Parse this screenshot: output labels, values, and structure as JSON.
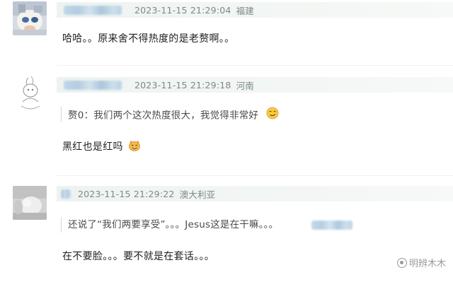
{
  "comments": [
    {
      "timestamp": "2023-11-15 21:29:04",
      "location": "福建",
      "text": "哈哈。。原来舍不得热度的是老赘啊。。"
    },
    {
      "timestamp": "2023-11-15 21:29:18",
      "location": "河南",
      "quote": "赘0：我们两个这次热度很大，我觉得非常好",
      "quote_emoji": "smirk-face-emoji",
      "text": "黑红也是红吗",
      "text_emoji": "cat-face-emoji"
    },
    {
      "timestamp": "2023-11-15 21:29:22",
      "location": "澳大利亚",
      "quote": "还说了“我们两要享受”。。。Jesus这是在干嘛。。。",
      "text": "在不要脸。。。要不就是在套话。。。"
    }
  ],
  "watermark": {
    "text": "明辨木木"
  },
  "colors": {
    "meta_bar": "#eef3f1",
    "meta_text": "#7c8a86",
    "name_blur": "#a7c6de",
    "comment_text": "#1f1f1f"
  }
}
